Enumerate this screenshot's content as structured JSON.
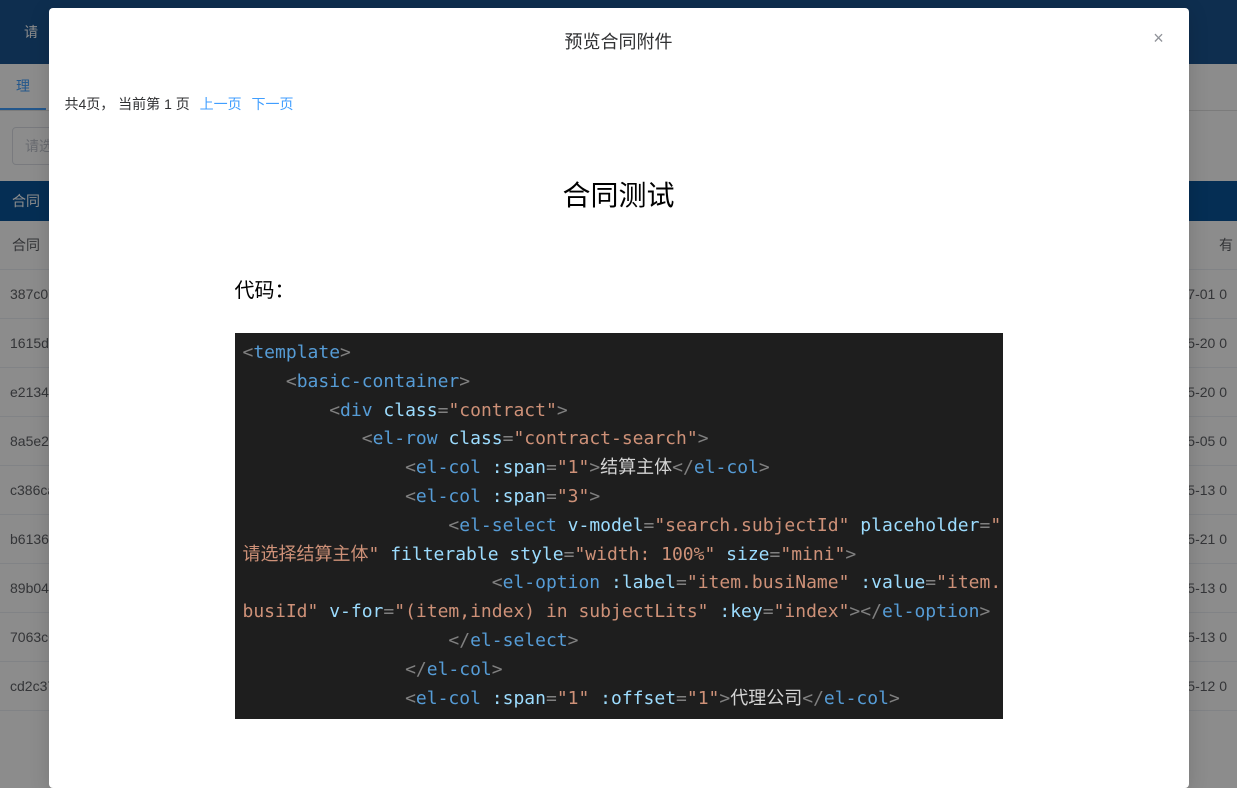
{
  "backdrop": {
    "header_text": "请",
    "tab_label": "理",
    "filter_placeholder": "请选",
    "action_button": "合同",
    "th_left": "合同",
    "th_right": "有",
    "rows": [
      {
        "id": "387c071",
        "date": "1-07-01 0"
      },
      {
        "id": "1615d4",
        "date": "1-05-20 0"
      },
      {
        "id": "e2134f",
        "date": "1-05-20 0"
      },
      {
        "id": "8a5e2b",
        "date": "1-05-05 0"
      },
      {
        "id": "c386ca",
        "date": "1-05-13 0"
      },
      {
        "id": "b6136d",
        "date": "1-05-21 0"
      },
      {
        "id": "89b046",
        "date": "1-05-13 0"
      },
      {
        "id": "7063c6",
        "date": "1-05-13 0"
      },
      {
        "id": "cd2c37",
        "date": "1-05-12 0"
      }
    ]
  },
  "modal": {
    "title": "预览合同附件",
    "close_label": "×",
    "pagination_prefix": "共4页， 当前第 1 页",
    "prev_label": "上一页",
    "next_label": "下一页",
    "doc_title": "合同测试",
    "section_label": "代码：",
    "code_lines": [
      [
        {
          "t": "punc",
          "v": "<"
        },
        {
          "t": "tag",
          "v": "template"
        },
        {
          "t": "punc",
          "v": ">"
        }
      ],
      [
        {
          "t": "ind",
          "v": "    "
        },
        {
          "t": "punc",
          "v": "<"
        },
        {
          "t": "tag",
          "v": "basic-container"
        },
        {
          "t": "punc",
          "v": ">"
        }
      ],
      [
        {
          "t": "ind",
          "v": "        "
        },
        {
          "t": "punc",
          "v": "<"
        },
        {
          "t": "tag",
          "v": "div"
        },
        {
          "t": "text",
          "v": " "
        },
        {
          "t": "attr",
          "v": "class"
        },
        {
          "t": "punc",
          "v": "="
        },
        {
          "t": "str",
          "v": "\"contract\""
        },
        {
          "t": "punc",
          "v": ">"
        }
      ],
      [
        {
          "t": "ind",
          "v": "           "
        },
        {
          "t": "punc",
          "v": "<"
        },
        {
          "t": "tag",
          "v": "el-row"
        },
        {
          "t": "text",
          "v": " "
        },
        {
          "t": "attr",
          "v": "class"
        },
        {
          "t": "punc",
          "v": "="
        },
        {
          "t": "str",
          "v": "\"contract-search\""
        },
        {
          "t": "punc",
          "v": ">"
        }
      ],
      [
        {
          "t": "ind",
          "v": "               "
        },
        {
          "t": "punc",
          "v": "<"
        },
        {
          "t": "tag",
          "v": "el-col"
        },
        {
          "t": "text",
          "v": " "
        },
        {
          "t": "attr",
          "v": ":span"
        },
        {
          "t": "punc",
          "v": "="
        },
        {
          "t": "str",
          "v": "\"1\""
        },
        {
          "t": "punc",
          "v": ">"
        },
        {
          "t": "text",
          "v": "结算主体"
        },
        {
          "t": "punc",
          "v": "</"
        },
        {
          "t": "tag",
          "v": "el-col"
        },
        {
          "t": "punc",
          "v": ">"
        }
      ],
      [
        {
          "t": "ind",
          "v": "               "
        },
        {
          "t": "punc",
          "v": "<"
        },
        {
          "t": "tag",
          "v": "el-col"
        },
        {
          "t": "text",
          "v": " "
        },
        {
          "t": "attr",
          "v": ":span"
        },
        {
          "t": "punc",
          "v": "="
        },
        {
          "t": "str",
          "v": "\"3\""
        },
        {
          "t": "punc",
          "v": ">"
        }
      ],
      [
        {
          "t": "ind",
          "v": "                   "
        },
        {
          "t": "punc",
          "v": "<"
        },
        {
          "t": "tag",
          "v": "el-select"
        },
        {
          "t": "text",
          "v": " "
        },
        {
          "t": "attr",
          "v": "v-model"
        },
        {
          "t": "punc",
          "v": "="
        },
        {
          "t": "str",
          "v": "\"search.subjectId\""
        },
        {
          "t": "text",
          "v": " "
        },
        {
          "t": "attr",
          "v": "placeholder"
        },
        {
          "t": "punc",
          "v": "="
        },
        {
          "t": "str",
          "v": "\""
        }
      ],
      [
        {
          "t": "str",
          "v": "请选择结算主体\""
        },
        {
          "t": "text",
          "v": " "
        },
        {
          "t": "attr",
          "v": "filterable"
        },
        {
          "t": "text",
          "v": " "
        },
        {
          "t": "attr",
          "v": "style"
        },
        {
          "t": "punc",
          "v": "="
        },
        {
          "t": "str",
          "v": "\"width: 100%\""
        },
        {
          "t": "text",
          "v": " "
        },
        {
          "t": "attr",
          "v": "size"
        },
        {
          "t": "punc",
          "v": "="
        },
        {
          "t": "str",
          "v": "\"mini\""
        },
        {
          "t": "punc",
          "v": ">"
        }
      ],
      [
        {
          "t": "ind",
          "v": "                       "
        },
        {
          "t": "punc",
          "v": "<"
        },
        {
          "t": "tag",
          "v": "el-option"
        },
        {
          "t": "text",
          "v": " "
        },
        {
          "t": "attr",
          "v": ":label"
        },
        {
          "t": "punc",
          "v": "="
        },
        {
          "t": "str",
          "v": "\"item.busiName\""
        },
        {
          "t": "text",
          "v": " "
        },
        {
          "t": "attr",
          "v": ":value"
        },
        {
          "t": "punc",
          "v": "="
        },
        {
          "t": "str",
          "v": "\"item."
        }
      ],
      [
        {
          "t": "str",
          "v": "busiId\""
        },
        {
          "t": "text",
          "v": " "
        },
        {
          "t": "attr",
          "v": "v-for"
        },
        {
          "t": "punc",
          "v": "="
        },
        {
          "t": "str",
          "v": "\"(item,index) in subjectLits\""
        },
        {
          "t": "text",
          "v": " "
        },
        {
          "t": "attr",
          "v": ":key"
        },
        {
          "t": "punc",
          "v": "="
        },
        {
          "t": "str",
          "v": "\"index\""
        },
        {
          "t": "punc",
          "v": "></"
        },
        {
          "t": "tag",
          "v": "el-option"
        },
        {
          "t": "punc",
          "v": ">"
        }
      ],
      [
        {
          "t": "ind",
          "v": "                   "
        },
        {
          "t": "punc",
          "v": "</"
        },
        {
          "t": "tag",
          "v": "el-select"
        },
        {
          "t": "punc",
          "v": ">"
        }
      ],
      [
        {
          "t": "ind",
          "v": "               "
        },
        {
          "t": "punc",
          "v": "</"
        },
        {
          "t": "tag",
          "v": "el-col"
        },
        {
          "t": "punc",
          "v": ">"
        }
      ],
      [
        {
          "t": "ind",
          "v": "               "
        },
        {
          "t": "punc",
          "v": "<"
        },
        {
          "t": "tag",
          "v": "el-col"
        },
        {
          "t": "text",
          "v": " "
        },
        {
          "t": "attr",
          "v": ":span"
        },
        {
          "t": "punc",
          "v": "="
        },
        {
          "t": "str",
          "v": "\"1\""
        },
        {
          "t": "text",
          "v": " "
        },
        {
          "t": "attr",
          "v": ":offset"
        },
        {
          "t": "punc",
          "v": "="
        },
        {
          "t": "str",
          "v": "\"1\""
        },
        {
          "t": "punc",
          "v": ">"
        },
        {
          "t": "text",
          "v": "代理公司"
        },
        {
          "t": "punc",
          "v": "</"
        },
        {
          "t": "tag",
          "v": "el-col"
        },
        {
          "t": "punc",
          "v": ">"
        }
      ]
    ]
  }
}
